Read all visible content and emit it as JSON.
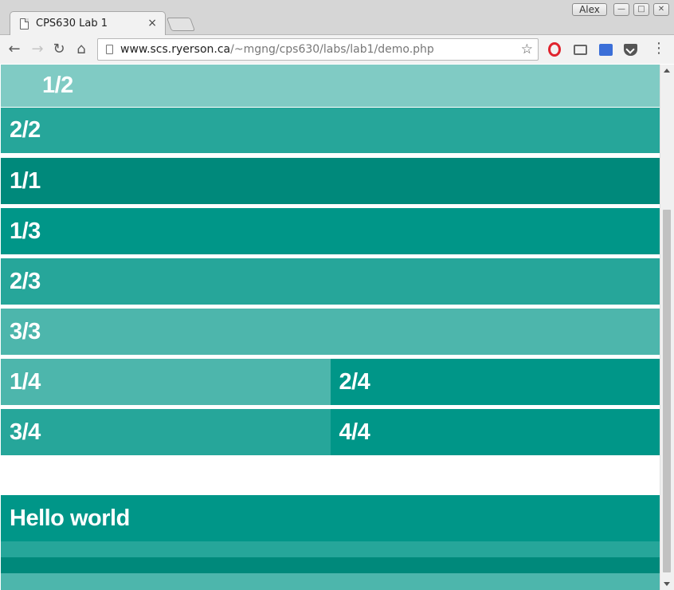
{
  "window": {
    "user_name": "Alex",
    "controls": {
      "minimize": "—",
      "maximize": "□",
      "close": "✕"
    }
  },
  "tab": {
    "title": "CPS630 Lab 1",
    "close_glyph": "×",
    "icon": "page-icon"
  },
  "toolbar": {
    "back_glyph": "←",
    "forward_glyph": "→",
    "reload_glyph": "↻",
    "home_glyph": "⌂",
    "url_host": "www.scs.ryerson.ca",
    "url_path": "/~mgng/cps630/labs/lab1/demo.php",
    "bookmark_glyph": "☆",
    "menu_glyph": "⋮",
    "extensions": [
      "opera-icon",
      "cast-icon",
      "extension-icon",
      "pocket-icon"
    ]
  },
  "page": {
    "rows": [
      {
        "cells": [
          {
            "label": "1/2",
            "color": "#80cbc4"
          }
        ]
      },
      {
        "cells": [
          {
            "label": "2/2",
            "color": "#26a69a"
          }
        ]
      },
      {
        "cells": [
          {
            "label": "1/1",
            "color": "#00897b"
          }
        ]
      },
      {
        "cells": [
          {
            "label": "1/3",
            "color": "#009688"
          }
        ]
      },
      {
        "cells": [
          {
            "label": "2/3",
            "color": "#26a69a"
          }
        ]
      },
      {
        "cells": [
          {
            "label": "3/3",
            "color": "#4db6ac"
          }
        ]
      },
      {
        "cells": [
          {
            "label": "1/4",
            "color": "#4db6ac"
          },
          {
            "label": "2/4",
            "color": "#009688"
          }
        ]
      },
      {
        "cells": [
          {
            "label": "3/4",
            "color": "#26a69a"
          },
          {
            "label": "4/4",
            "color": "#009688"
          }
        ]
      },
      {
        "cells": [
          {
            "label": "Hello world",
            "color": "#009688"
          }
        ]
      },
      {
        "cells": [
          {
            "label": "",
            "color": "#26a69a"
          }
        ]
      },
      {
        "cells": [
          {
            "label": "",
            "color": "#00897b"
          }
        ]
      },
      {
        "cells": [
          {
            "label": "",
            "color": "#4db6ac"
          }
        ]
      }
    ]
  }
}
